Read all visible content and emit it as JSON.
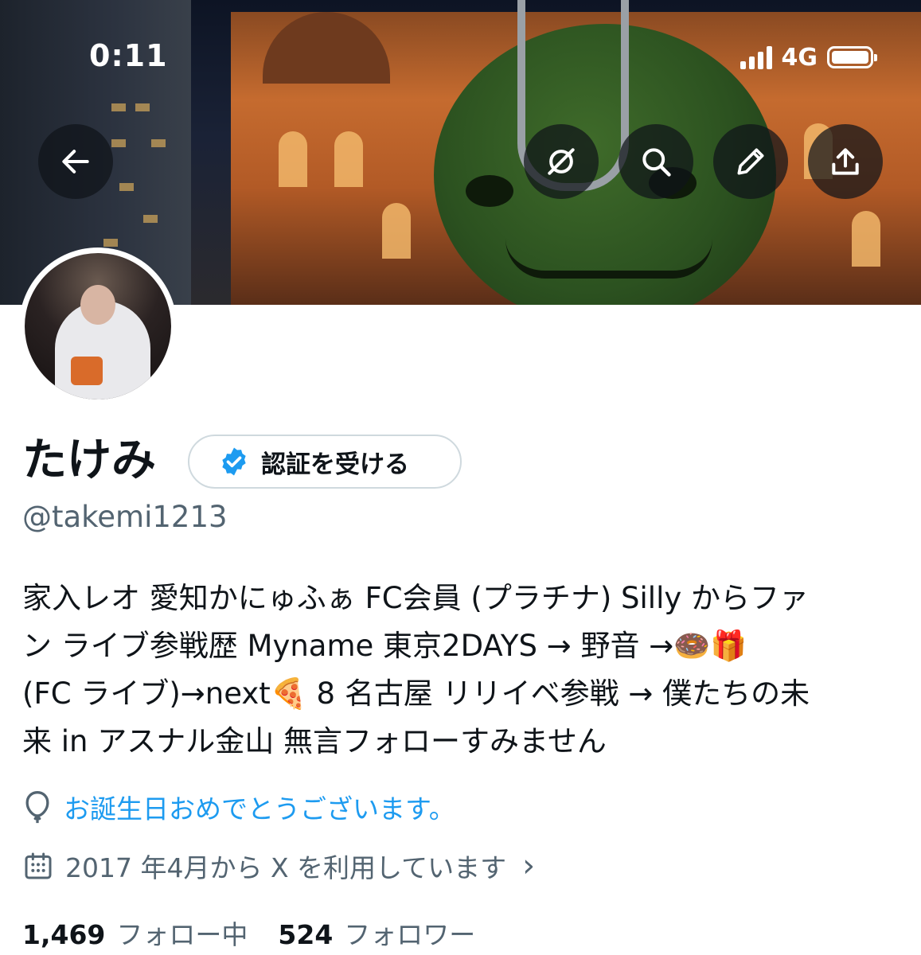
{
  "status_bar": {
    "time": "0:11",
    "network": "4G"
  },
  "nav": {
    "icons": [
      "back-arrow-icon",
      "grok-icon",
      "search-icon",
      "pencil-icon",
      "share-icon"
    ]
  },
  "profile": {
    "name": "たけみ",
    "verify_button": "認証を受ける",
    "handle": "@takemi1213",
    "bio_lines": [
      "家入レオ 愛知かにゅふぁ FC会員 (プラチナ) Silly からファ",
      "ン ライブ参戦歴 Myname 東京2DAYS → 野音 →🍩🎁",
      "(FC ライブ)→next🍕 8 名古屋 リリイベ参戦 → 僕たちの未",
      "来 in アスナル金山 無言フォローすみません"
    ],
    "birthday_text": "お誕生日おめでとうございます。",
    "joined_text": "2017 年4月から X を利用しています",
    "following_count": "1,469",
    "following_label": "フォロー中",
    "followers_count": "524",
    "followers_label": "フォロワー"
  },
  "colors": {
    "accent": "#1d9bf0",
    "text": "#0f1419",
    "secondary": "#536471"
  }
}
